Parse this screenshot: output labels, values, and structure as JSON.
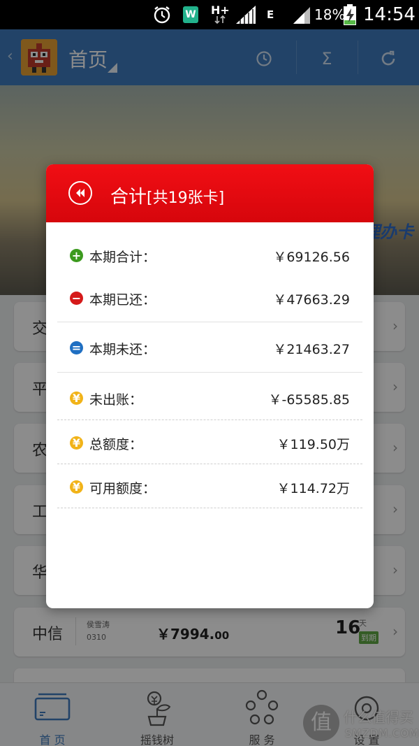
{
  "status_bar": {
    "network_hplus": "H+",
    "network_e": "E",
    "battery_percent": "18%",
    "time": "14:54",
    "wps_label": "W"
  },
  "appbar": {
    "back_glyph": "‹",
    "title": "首页",
    "icons": [
      "clock-icon",
      "sigma-icon",
      "refresh-icon"
    ],
    "sigma_glyph": "Σ"
  },
  "banner": {
    "text": "理办卡"
  },
  "cards": [
    {
      "bank": "交"
    },
    {
      "bank": "平"
    },
    {
      "bank": "农"
    },
    {
      "bank": "工"
    },
    {
      "bank": "华"
    },
    {
      "bank": "中信",
      "holder": "侯雪涛",
      "card_tail": "0310",
      "amount_main": "￥7994.",
      "amount_cents": "00",
      "days": "16",
      "days_unit": "天",
      "badge": "到期"
    }
  ],
  "bottom_nav": {
    "items": [
      {
        "label": "首 页",
        "icon": "card-icon",
        "active": true
      },
      {
        "label": "摇钱树",
        "icon": "money-tree-icon",
        "active": false
      },
      {
        "label": "服 务",
        "icon": "service-icon",
        "active": false
      },
      {
        "label": "设 置",
        "icon": "gear-icon",
        "active": false
      }
    ]
  },
  "watermark": {
    "glyph": "值",
    "line1": "什么值得买",
    "line2": "SMZDM.COM"
  },
  "modal": {
    "title": "合计",
    "subtitle": "[共19张卡]",
    "rows": [
      {
        "label": "本期合计：",
        "value": "￥69126.56",
        "icon": "plus-circle-icon",
        "icon_color": "#3c9a1e",
        "glyph": "+"
      },
      {
        "label": "本期已还：",
        "value": "￥47663.29",
        "icon": "minus-circle-icon",
        "icon_color": "#d51a1a",
        "glyph": "−"
      },
      {
        "label": "本期未还：",
        "value": "￥21463.27",
        "icon": "equals-circle-icon",
        "icon_color": "#1f6fc2",
        "glyph": "="
      },
      {
        "label": "未出账：",
        "value": "￥-65585.85",
        "icon": "yen-circle-icon",
        "icon_color": "#f1b318",
        "glyph": "¥"
      },
      {
        "label": "总额度：",
        "value": "￥119.50万",
        "icon": "yen-circle-icon",
        "icon_color": "#f1b318",
        "glyph": "¥"
      },
      {
        "label": "可用额度：",
        "value": "￥114.72万",
        "icon": "yen-circle-icon",
        "icon_color": "#f1b318",
        "glyph": "¥"
      }
    ]
  },
  "colors": {
    "appbar": "#3f7bbd",
    "modal_header": "#e20a10",
    "active_nav": "#3f7bbd"
  }
}
